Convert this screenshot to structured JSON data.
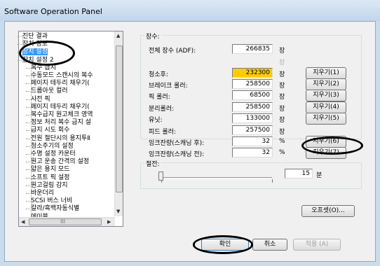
{
  "window": {
    "title": "Software Operation Panel"
  },
  "tree": {
    "items": [
      {
        "label": "진단 결과",
        "selected": false
      },
      {
        "label": "장치 정보",
        "selected": false
      },
      {
        "label": "장치 설정",
        "selected": true
      },
      {
        "label": "장치 설정 2",
        "selected": false
      },
      {
        "label": "복수 급지",
        "selected": false
      },
      {
        "label": "수동모드 스캔시의 복수",
        "selected": false
      },
      {
        "label": "페이지 테두리 채우기(",
        "selected": false
      },
      {
        "label": "드롭아웃 컬러",
        "selected": false
      },
      {
        "label": "사전 픽",
        "selected": false
      },
      {
        "label": "페이지 테두리 채우기(",
        "selected": false
      },
      {
        "label": "복수급지 원고체크 영역",
        "selected": false
      },
      {
        "label": "정보 처리 복수 급지 설",
        "selected": false
      },
      {
        "label": "급지 시도 회수",
        "selected": false
      },
      {
        "label": "전원 절단시의 용지투Ⅱ",
        "selected": false
      },
      {
        "label": "청소주기의 설정",
        "selected": false
      },
      {
        "label": "수명 설정 카운터",
        "selected": false
      },
      {
        "label": "원고 운송 간격의 설정",
        "selected": false
      },
      {
        "label": "얇은 용지 모드",
        "selected": false
      },
      {
        "label": "소프트 픽 설정",
        "selected": false
      },
      {
        "label": "원고걸림 감지",
        "selected": false
      },
      {
        "label": "바운더리",
        "selected": false
      },
      {
        "label": "SCSI 버스 너비",
        "selected": false
      },
      {
        "label": "칼라/흑백자동식별",
        "selected": false
      },
      {
        "label": "에이블…",
        "selected": false
      }
    ],
    "hscroll_label": "III"
  },
  "counts": {
    "group_title": "장수:",
    "rows": [
      {
        "label": "전체 장수 (ADF):",
        "value": "266835",
        "unit": "장",
        "highlight": false,
        "button": ""
      },
      {
        "label": "",
        "value": "",
        "unit": "장",
        "highlight": false,
        "button": "",
        "dim": true
      },
      {
        "label": "청소후:",
        "value": "232300",
        "unit": "장",
        "highlight": true,
        "button": "지우기(1)"
      },
      {
        "label": "브레이크 롤러:",
        "value": "258500",
        "unit": "장",
        "highlight": false,
        "button": "지우기(2)"
      },
      {
        "label": "픽 롤러:",
        "value": "68500",
        "unit": "장",
        "highlight": false,
        "button": "지우기(3)"
      },
      {
        "label": "분리롤러:",
        "value": "258500",
        "unit": "장",
        "highlight": false,
        "button": "지우기(4)"
      },
      {
        "label": "유닛:",
        "value": "133000",
        "unit": "장",
        "highlight": false,
        "button": "지우기(5)"
      },
      {
        "label": "피드 롤러:",
        "value": "257500",
        "unit": "장",
        "highlight": false,
        "button": ""
      },
      {
        "label": "잉크잔량(스캐닝 후):",
        "value": "32",
        "unit": "%",
        "highlight": false,
        "button": "지우기(6)"
      },
      {
        "label": "잉크잔량(스캐닝 전):",
        "value": "32",
        "unit": "%",
        "highlight": false,
        "button": "지우기(7)"
      }
    ]
  },
  "power_save": {
    "group_title": "절전:",
    "value": "15",
    "unit": "분",
    "level": 0
  },
  "buttons": {
    "offset": "오프셋(O)...",
    "ok": "확인",
    "cancel": "취소",
    "apply": "적용 (A)"
  },
  "colors": {
    "highlight": "#ffcc00",
    "selection": "#3399ff"
  }
}
